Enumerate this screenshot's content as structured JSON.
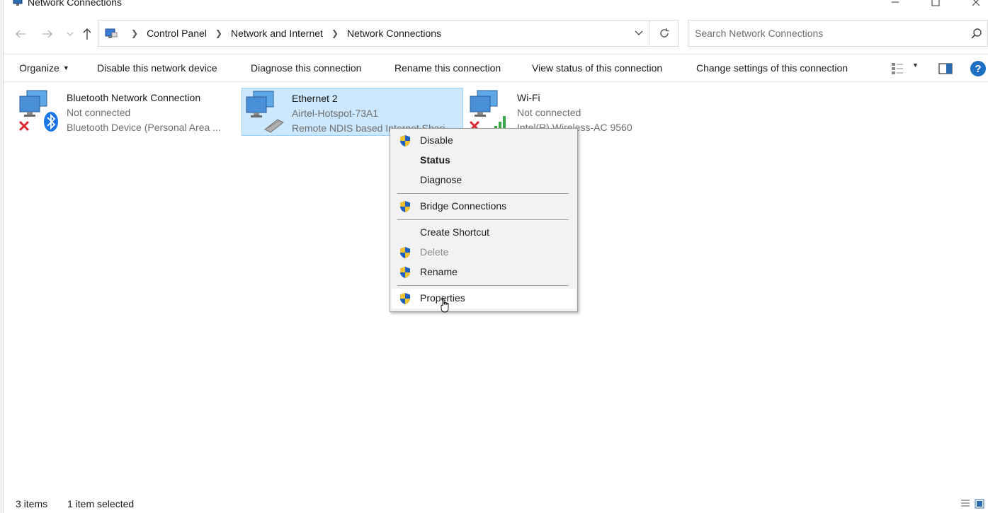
{
  "window": {
    "title": "Network Connections"
  },
  "nav": {
    "breadcrumbs": [
      "Control Panel",
      "Network and Internet",
      "Network Connections"
    ]
  },
  "search": {
    "placeholder": "Search Network Connections"
  },
  "toolbar": {
    "organize": "Organize",
    "disable_device": "Disable this network device",
    "diagnose": "Diagnose this connection",
    "rename": "Rename this connection",
    "view_status": "View status of this connection",
    "change_settings": "Change settings of this connection",
    "help": "?"
  },
  "connections": [
    {
      "name": "Bluetooth Network Connection",
      "status": "Not connected",
      "device": "Bluetooth Device (Personal Area ...",
      "icon": "bluetooth-network-icon",
      "selected": false
    },
    {
      "name": "Ethernet 2",
      "status": "Airtel-Hotspot-73A1",
      "device": "Remote NDIS based Internet Shari",
      "icon": "ethernet-network-icon",
      "selected": true
    },
    {
      "name": "Wi-Fi",
      "status": "Not connected",
      "device": "Intel(R) Wireless-AC 9560",
      "icon": "wifi-network-icon",
      "selected": false
    }
  ],
  "context_menu": {
    "items": [
      {
        "label": "Disable",
        "shield": true,
        "bold": false,
        "disabled": false
      },
      {
        "label": "Status",
        "shield": false,
        "bold": true,
        "disabled": false
      },
      {
        "label": "Diagnose",
        "shield": false,
        "bold": false,
        "disabled": false
      },
      {
        "label": "Bridge Connections",
        "shield": true,
        "bold": false,
        "disabled": false
      },
      {
        "label": "Create Shortcut",
        "shield": false,
        "bold": false,
        "disabled": false
      },
      {
        "label": "Delete",
        "shield": true,
        "bold": false,
        "disabled": true
      },
      {
        "label": "Rename",
        "shield": true,
        "bold": false,
        "disabled": false
      },
      {
        "label": "Properties",
        "shield": true,
        "bold": false,
        "disabled": false,
        "hovered": true
      }
    ]
  },
  "status": {
    "count": "3 items",
    "selected": "1 item selected"
  },
  "colors": {
    "selection": "#cce8ff",
    "selection_border": "#99d1ff",
    "menu_bg": "#f2f2f2",
    "help": "#1c6fc3"
  }
}
